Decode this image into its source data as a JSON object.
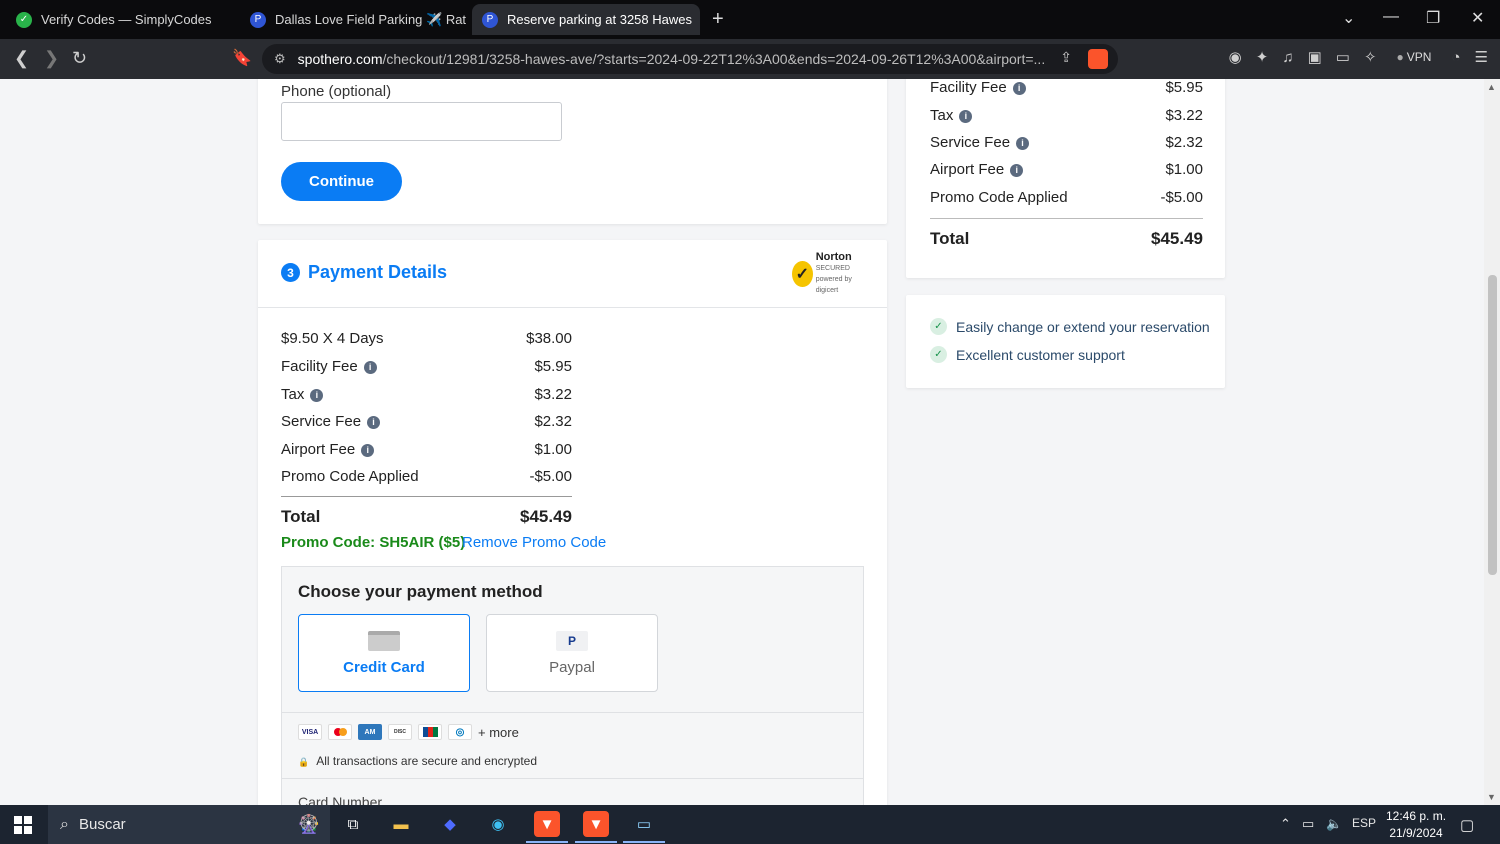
{
  "browser": {
    "tabs": [
      {
        "title": "Verify Codes — SimplyCodes",
        "icon": "simplycodes-icon",
        "active": false
      },
      {
        "title": "Dallas Love Field Parking ✈️ Rates",
        "icon": "spothero-icon",
        "active": false
      },
      {
        "title": "Reserve parking at 3258 Hawes",
        "icon": "spothero-icon",
        "active": true
      }
    ],
    "url_domain": "spothero.com",
    "url_path": "/checkout/12981/3258-hawes-ave/?starts=2024-09-22T12%3A00&ends=2024-09-26T12%3A00&airport=...",
    "vpn_label": "VPN"
  },
  "contact": {
    "phone_label": "Phone (optional)",
    "phone_value": "",
    "continue_label": "Continue"
  },
  "payment": {
    "step_number": "3",
    "title": "Payment Details",
    "norton_label": "Norton",
    "norton_sub": "SECURED",
    "norton_powered": "powered by digicert",
    "lines": [
      {
        "label": "$9.50 X 4 Days",
        "amount": "$38.00",
        "info": false
      },
      {
        "label": "Facility Fee",
        "amount": "$5.95",
        "info": true
      },
      {
        "label": "Tax",
        "amount": "$3.22",
        "info": true
      },
      {
        "label": "Service Fee",
        "amount": "$2.32",
        "info": true
      },
      {
        "label": "Airport Fee",
        "amount": "$1.00",
        "info": true
      },
      {
        "label": "Promo Code Applied",
        "amount": "-$5.00",
        "info": false
      }
    ],
    "total_label": "Total",
    "total_amount": "$45.49",
    "promo_text": "Promo Code: SH5AIR ($5)",
    "remove_promo": "Remove Promo Code",
    "method_heading": "Choose your payment method",
    "methods": [
      {
        "label": "Credit Card",
        "selected": true
      },
      {
        "label": "Paypal",
        "selected": false
      }
    ],
    "brands": [
      "VISA",
      "MC",
      "AMEX",
      "DISCOVER",
      "JCB",
      "DINERS"
    ],
    "more_label": "+ more",
    "secure_text": "All transactions are secure and encrypted",
    "card_number_label": "Card Number"
  },
  "summary": {
    "lines": [
      {
        "label": "Facility Fee",
        "amount": "$5.95",
        "info": true
      },
      {
        "label": "Tax",
        "amount": "$3.22",
        "info": true
      },
      {
        "label": "Service Fee",
        "amount": "$2.32",
        "info": true
      },
      {
        "label": "Airport Fee",
        "amount": "$1.00",
        "info": true
      },
      {
        "label": "Promo Code Applied",
        "amount": "-$5.00",
        "info": false
      }
    ],
    "total_label": "Total",
    "total_amount": "$45.49",
    "features": [
      "Easily change or extend your reservation",
      "Excellent customer support"
    ]
  },
  "taskbar": {
    "search_placeholder": "Buscar",
    "language": "ESP",
    "time": "12:46 p. m.",
    "date": "21/9/2024"
  },
  "colors": {
    "accent": "#0a7cf4",
    "promo_green": "#1a8a1a"
  }
}
